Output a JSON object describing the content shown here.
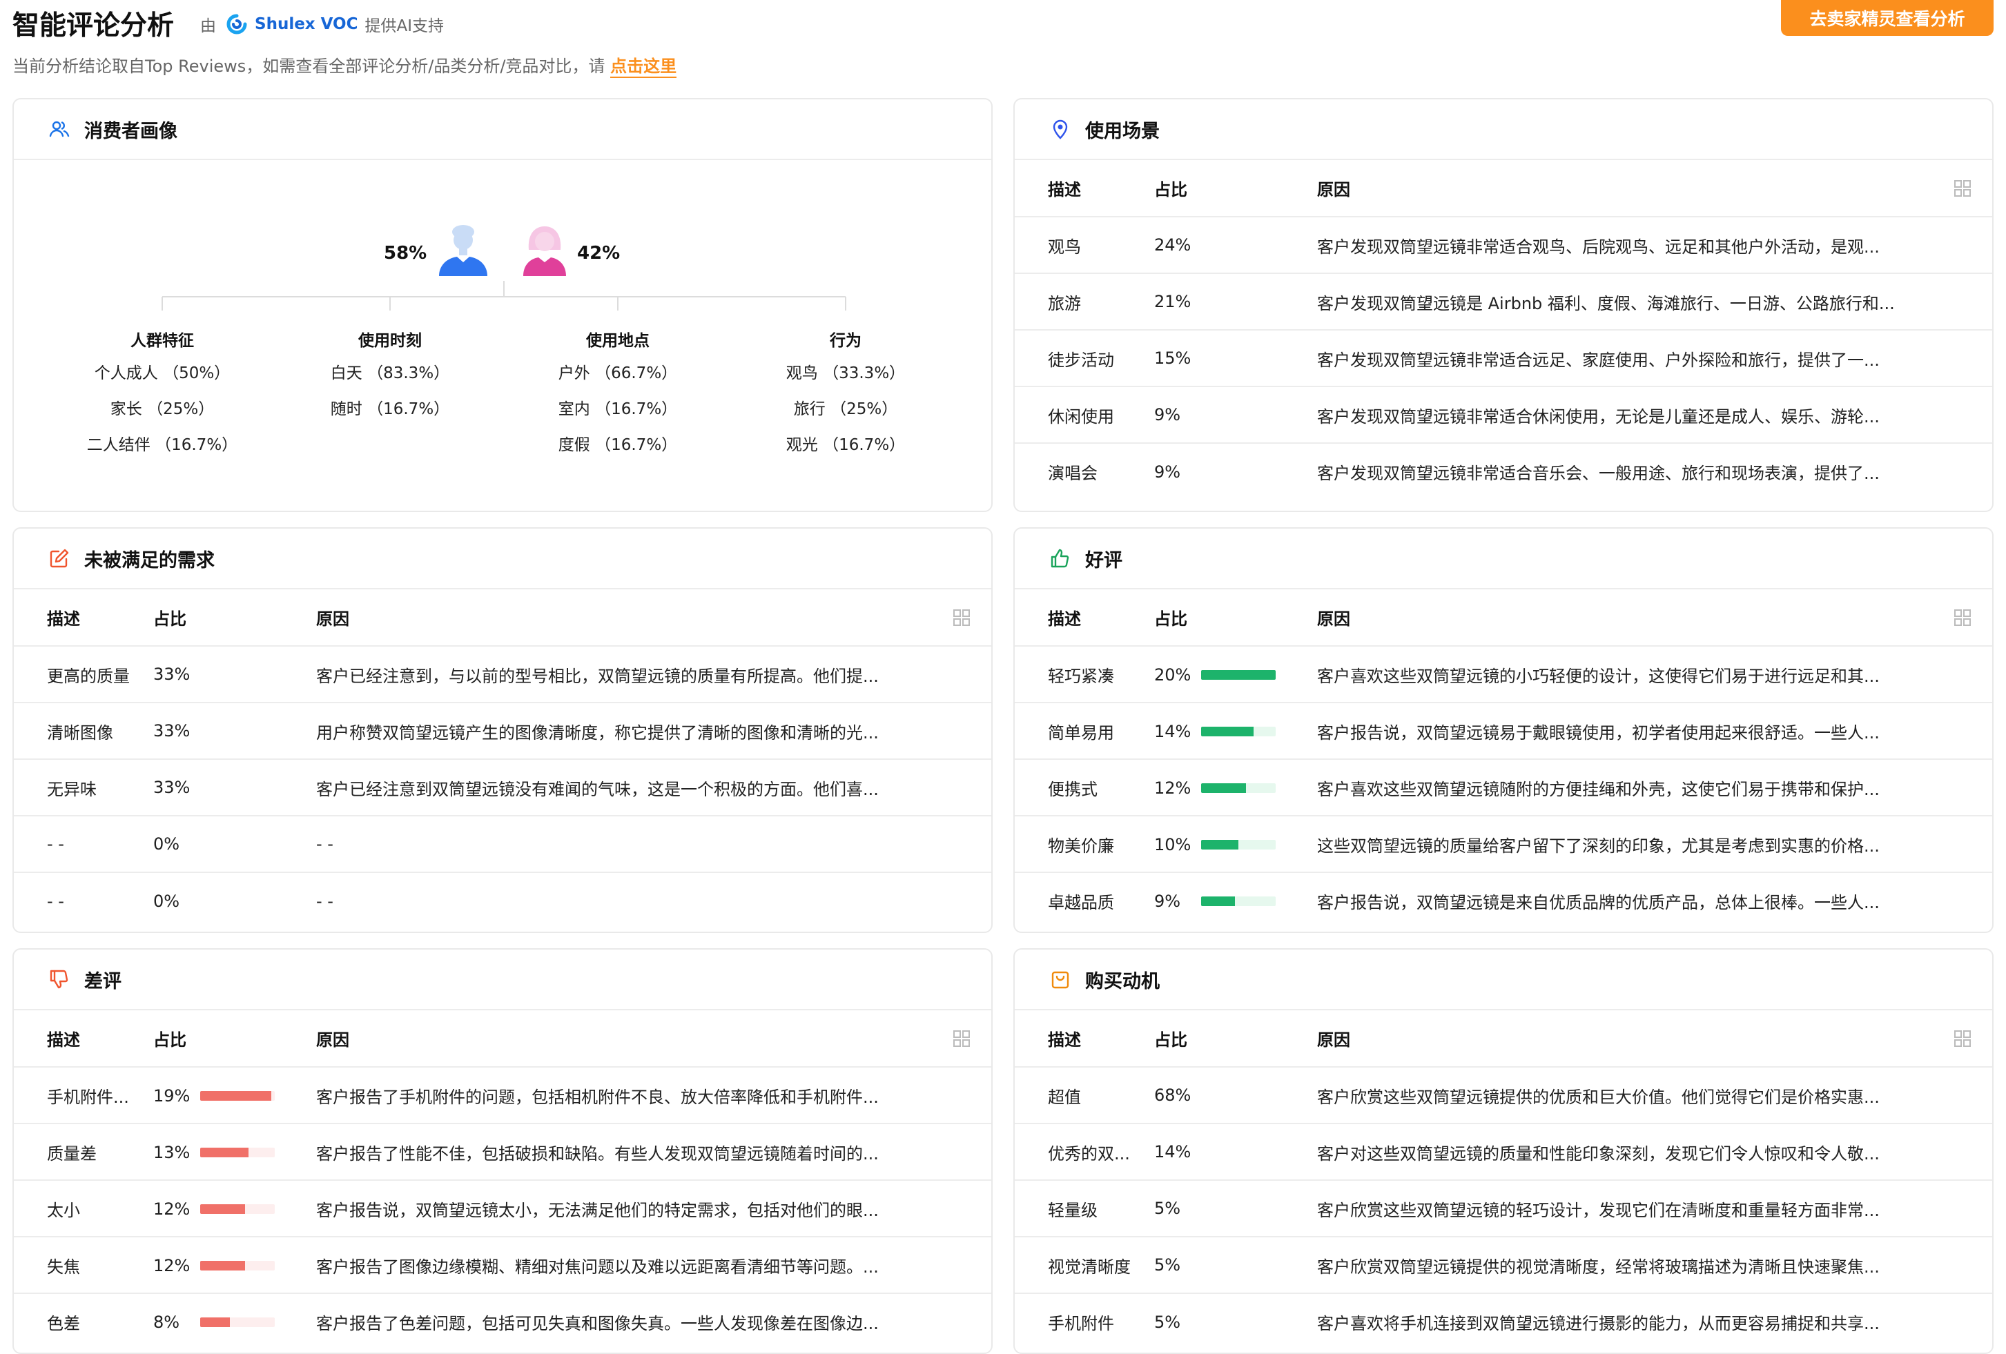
{
  "header": {
    "title": "智能评论分析",
    "powered_prefix": "由",
    "brand": "Shulex VOC",
    "powered_suffix": "提供AI支持",
    "cta_button": "去卖家精灵查看分析",
    "notice_text": "当前分析结论取自Top Reviews，如需查看全部评论分析/品类分析/竞品对比，请",
    "notice_link": "点击这里"
  },
  "colors": {
    "accent_orange": "#fb8f1d",
    "brand_blue": "#1766d6",
    "positive_green": "#1db36b",
    "negative_red": "#f07068"
  },
  "table_headers": {
    "desc": "描述",
    "ratio": "占比",
    "reason": "原因"
  },
  "consumer": {
    "title": "消费者画像",
    "icon": "users-icon",
    "male_pct": "58%",
    "female_pct": "42%",
    "columns": [
      {
        "title": "人群特征",
        "items": [
          "个人成人 （50%）",
          "家长 （25%）",
          "二人结伴 （16.7%）"
        ]
      },
      {
        "title": "使用时刻",
        "items": [
          "白天 （83.3%）",
          "随时 （16.7%）"
        ]
      },
      {
        "title": "使用地点",
        "items": [
          "户外 （66.7%）",
          "室内 （16.7%）",
          "度假 （16.7%）"
        ]
      },
      {
        "title": "行为",
        "items": [
          "观鸟 （33.3%）",
          "旅行 （25%）",
          "观光 （16.7%）"
        ]
      }
    ]
  },
  "scenes": {
    "title": "使用场景",
    "icon": "location-pin-icon",
    "rows": [
      {
        "desc": "观鸟",
        "pct": "24%",
        "reason": "客户发现双筒望远镜非常适合观鸟、后院观鸟、远足和其他户外活动，是观..."
      },
      {
        "desc": "旅游",
        "pct": "21%",
        "reason": "客户发现双筒望远镜是 Airbnb 福利、度假、海滩旅行、一日游、公路旅行和..."
      },
      {
        "desc": "徒步活动",
        "pct": "15%",
        "reason": "客户发现双筒望远镜非常适合远足、家庭使用、户外探险和旅行，提供了一..."
      },
      {
        "desc": "休闲使用",
        "pct": "9%",
        "reason": "客户发现双筒望远镜非常适合休闲使用，无论是儿童还是成人、娱乐、游轮..."
      },
      {
        "desc": "演唱会",
        "pct": "9%",
        "reason": "客户发现双筒望远镜非常适合音乐会、一般用途、旅行和现场表演，提供了..."
      }
    ]
  },
  "unmet": {
    "title": "未被满足的需求",
    "icon": "edit-icon",
    "rows": [
      {
        "desc": "更高的质量",
        "pct": "33%",
        "reason": "客户已经注意到，与以前的型号相比，双筒望远镜的质量有所提高。他们提..."
      },
      {
        "desc": "清晰图像",
        "pct": "33%",
        "reason": "用户称赞双筒望远镜产生的图像清晰度，称它提供了清晰的图像和清晰的光..."
      },
      {
        "desc": "无异味",
        "pct": "33%",
        "reason": "客户已经注意到双筒望远镜没有难闻的气味，这是一个积极的方面。他们喜..."
      },
      {
        "desc": "- -",
        "pct": "0%",
        "reason": "- -"
      },
      {
        "desc": "- -",
        "pct": "0%",
        "reason": "- -"
      }
    ]
  },
  "positive": {
    "title": "好评",
    "icon": "thumbs-up-icon",
    "rows": [
      {
        "desc": "轻巧紧凑",
        "pct": "20%",
        "value": 20,
        "reason": "客户喜欢这些双筒望远镜的小巧轻便的设计，这使得它们易于进行远足和其..."
      },
      {
        "desc": "简单易用",
        "pct": "14%",
        "value": 14,
        "reason": "客户报告说，双筒望远镜易于戴眼镜使用，初学者使用起来很舒适。一些人..."
      },
      {
        "desc": "便携式",
        "pct": "12%",
        "value": 12,
        "reason": "客户喜欢这些双筒望远镜随附的方便挂绳和外壳，这使它们易于携带和保护..."
      },
      {
        "desc": "物美价廉",
        "pct": "10%",
        "value": 10,
        "reason": "这些双筒望远镜的质量给客户留下了深刻的印象，尤其是考虑到实惠的价格..."
      },
      {
        "desc": "卓越品质",
        "pct": "9%",
        "value": 9,
        "reason": "客户报告说，双筒望远镜是来自优质品牌的优质产品，总体上很棒。一些人..."
      }
    ]
  },
  "negative": {
    "title": "差评",
    "icon": "thumbs-down-icon",
    "rows": [
      {
        "desc": "手机附件...",
        "pct": "19%",
        "value": 19,
        "reason": "客户报告了手机附件的问题，包括相机附件不良、放大倍率降低和手机附件..."
      },
      {
        "desc": "质量差",
        "pct": "13%",
        "value": 13,
        "reason": "客户报告了性能不佳，包括破损和缺陷。有些人发现双筒望远镜随着时间的..."
      },
      {
        "desc": "太小",
        "pct": "12%",
        "value": 12,
        "reason": "客户报告说，双筒望远镜太小，无法满足他们的特定需求，包括对他们的眼..."
      },
      {
        "desc": "失焦",
        "pct": "12%",
        "value": 12,
        "reason": "客户报告了图像边缘模糊、精细对焦问题以及难以远距离看清细节等问题。..."
      },
      {
        "desc": "色差",
        "pct": "8%",
        "value": 8,
        "reason": "客户报告了色差问题，包括可见失真和图像失真。一些人发现像差在图像边..."
      }
    ]
  },
  "motivation": {
    "title": "购买动机",
    "icon": "shopping-bag-icon",
    "rows": [
      {
        "desc": "超值",
        "pct": "68%",
        "reason": "客户欣赏这些双筒望远镜提供的优质和巨大价值。他们觉得它们是价格实惠..."
      },
      {
        "desc": "优秀的双...",
        "pct": "14%",
        "reason": "客户对这些双筒望远镜的质量和性能印象深刻，发现它们令人惊叹和令人敬..."
      },
      {
        "desc": "轻量级",
        "pct": "5%",
        "reason": "客户欣赏这些双筒望远镜的轻巧设计，发现它们在清晰度和重量轻方面非常..."
      },
      {
        "desc": "视觉清晰度",
        "pct": "5%",
        "reason": "客户欣赏双筒望远镜提供的视觉清晰度，经常将玻璃描述为清晰且快速聚焦..."
      },
      {
        "desc": "手机附件",
        "pct": "5%",
        "reason": "客户喜欢将手机连接到双筒望远镜进行摄影的能力，从而更容易捕捉和共享..."
      }
    ]
  }
}
